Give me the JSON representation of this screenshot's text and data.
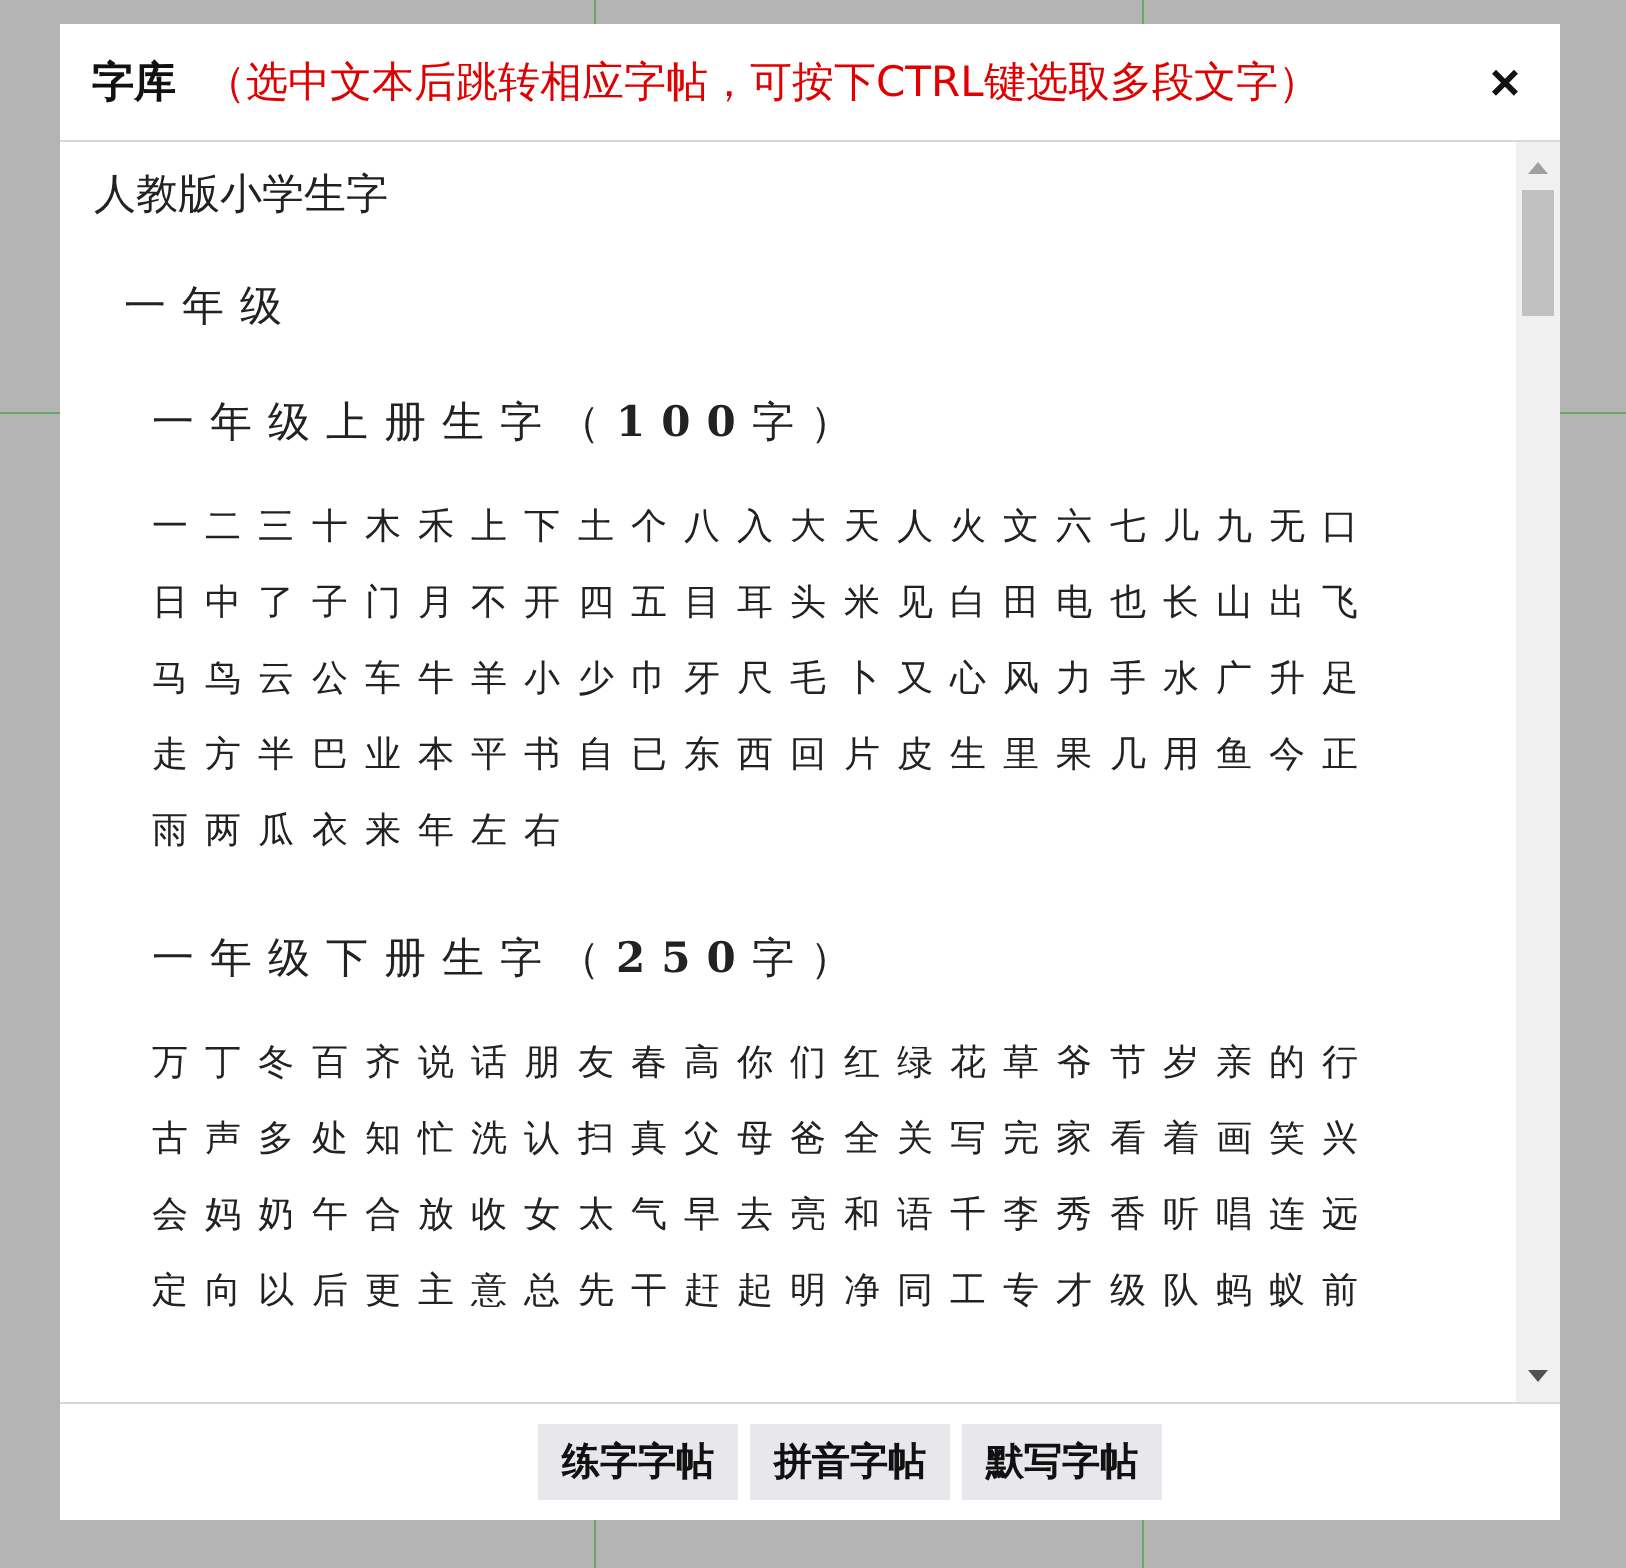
{
  "dialog": {
    "title": "字库",
    "hint": "（选中文本后跳转相应字帖，可按下CTRL键选取多段文字）",
    "close": "×"
  },
  "library": {
    "title": "人教版小学生字",
    "grades": [
      {
        "title": "一年级",
        "volumes": [
          {
            "title": "一年级上册生字（**100**字）",
            "rows": [
              "一二三十木禾上下土个八入大天人火文六七儿九无口",
              "日中了子门月不开四五目耳头米见白田电也长山出飞",
              "马鸟云公车牛羊小少巾牙尺毛卜又心风力手水广升足",
              "走方半巴业本平书自已东西回片皮生里果几用鱼今正",
              "雨两瓜衣来年左右"
            ]
          },
          {
            "title": "一年级下册生字（**250**字）",
            "rows": [
              "万丁冬百齐说话朋友春高你们红绿花草爷节岁亲的行",
              "古声多处知忙洗认扫真父母爸全关写完家看着画笑兴",
              "会妈奶午合放收女太气早去亮和语千李秀香听唱连远",
              "定向以后更主意总先干赶起明净同工专才级队蚂蚁前"
            ]
          }
        ]
      }
    ]
  },
  "buttons": [
    "练字字帖",
    "拼音字帖",
    "默写字帖"
  ]
}
